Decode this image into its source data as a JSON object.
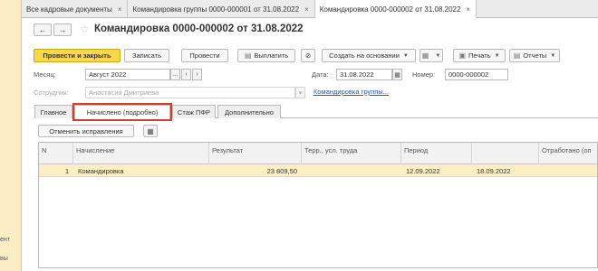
{
  "left_panel": {
    "texts": [
      "ент",
      "вы"
    ]
  },
  "window_tabs": [
    {
      "label": "Все кадровые документы",
      "close": "×"
    },
    {
      "label": "Командировка группы 0000-000001 от 31.08.2022",
      "close": "×"
    },
    {
      "label": "Командировка 0000-000002 от 31.08.2022",
      "close": "×",
      "active": true
    }
  ],
  "nav": {
    "back": "←",
    "forward": "→",
    "star": "☆"
  },
  "document": {
    "title": "Командировка 0000-000002 от 31.08.2022"
  },
  "toolbar": {
    "post_close": "Провести и закрыть",
    "save": "Записать",
    "post": "Провести",
    "pay": "Выплатить",
    "create_based": "Создать на основании",
    "print": "Печать",
    "reports": "Отчеты"
  },
  "form": {
    "month_label": "Месяц:",
    "month_value": "Август 2022",
    "date_label": "Дата:",
    "date_value": "31.08.2022",
    "number_label": "Номер:",
    "number_value": "0000-000002",
    "employee_label": "Сотрудник:",
    "employee_value": "Анастасия Дмитриева",
    "group_link": "Командировка группы..."
  },
  "form_tabs": [
    "Главное",
    "Начислено (подробно)",
    "Стаж ПФР",
    "Дополнительно"
  ],
  "cancel_corrections": "Отменить исправления",
  "grid": {
    "headers": [
      "N",
      "Начисление",
      "Результат",
      "Терр., усл. труда",
      "Период",
      "",
      "Отработано (оп"
    ],
    "rows": [
      {
        "n": "1",
        "accrual": "Командировка",
        "result": "23 809,50",
        "terr": "",
        "period_from": "12.09.2022",
        "period_to": "18.09.2022",
        "worked": ""
      }
    ]
  }
}
